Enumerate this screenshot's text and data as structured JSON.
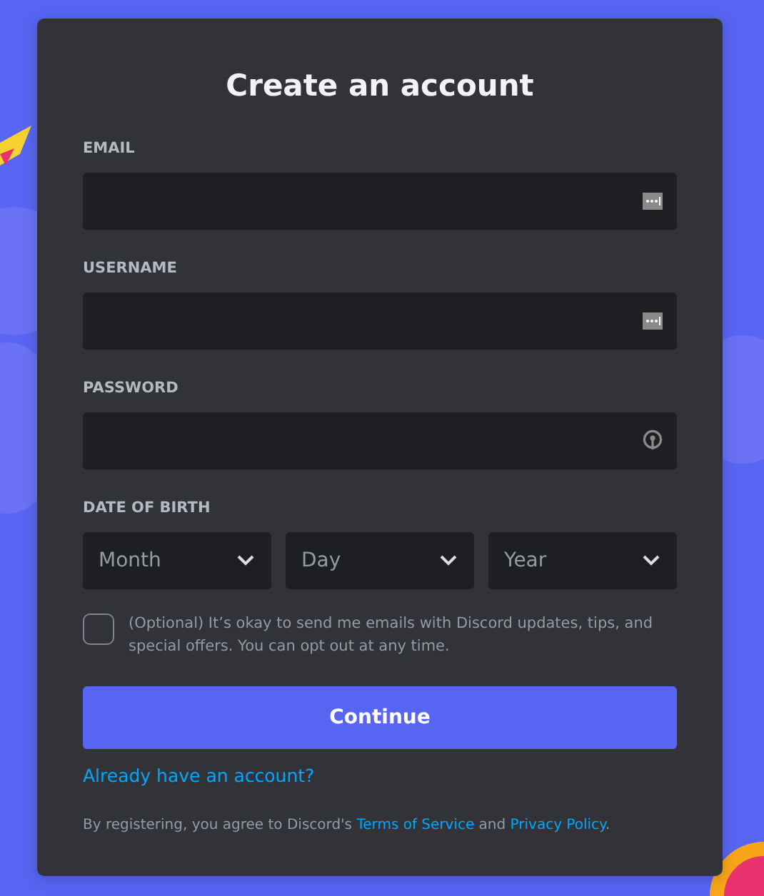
{
  "title": "Create an account",
  "fields": [
    {
      "label": "EMAIL",
      "kind": "text"
    },
    {
      "label": "USERNAME",
      "kind": "text"
    },
    {
      "label": "PASSWORD",
      "kind": "password"
    }
  ],
  "birth": {
    "label": "DATE OF BIRTH",
    "selects": [
      {
        "placeholder": "Month"
      },
      {
        "placeholder": "Day"
      },
      {
        "placeholder": "Year"
      }
    ]
  },
  "opt_in": {
    "checked": false,
    "text": "(Optional) It’s okay to send me emails with Discord updates, tips, and special offers. You can opt out at any time."
  },
  "continue_button": "Continue",
  "login_link": "Already have an account?",
  "footer": [
    {
      "kind": "text",
      "text": "By registering, you agree to Discord's "
    },
    {
      "kind": "link",
      "text": "Terms of Service"
    },
    {
      "kind": "text",
      "text": " and "
    },
    {
      "kind": "link",
      "text": "Privacy Policy"
    },
    {
      "kind": "text",
      "text": "."
    }
  ]
}
